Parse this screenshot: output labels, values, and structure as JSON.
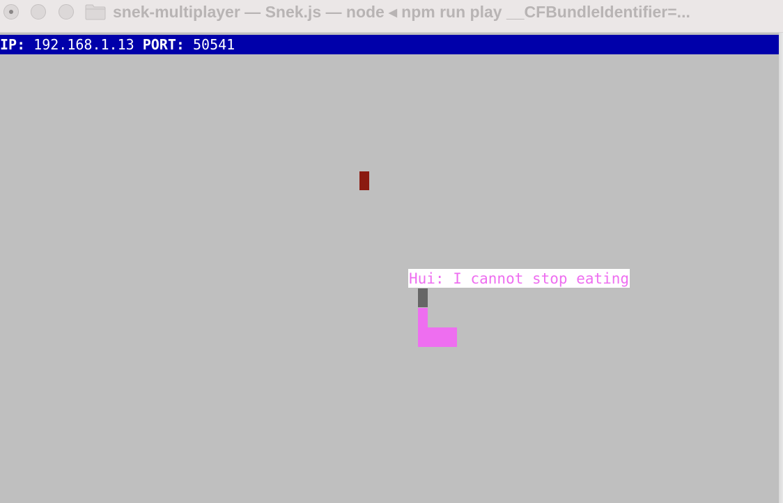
{
  "window": {
    "title": "snek-multiplayer — Snek.js — node ◂ npm run play __CFBundleIdentifier=..."
  },
  "status": {
    "ip_label": "IP:",
    "ip_value": "192.168.1.13",
    "port_label": "PORT:",
    "port_value": "50541"
  },
  "game": {
    "chat": {
      "player": "Hui",
      "message": "Hui: I cannot stop eating"
    },
    "colors": {
      "background": "#bfbfbf",
      "statusbar": "#0000aa",
      "snake": "#ee6ef0",
      "snake_head": "#666666",
      "food": "#8b1a10"
    }
  },
  "icons": {
    "close": "close-button-icon",
    "minimize": "minimize-button-icon",
    "zoom": "zoom-button-icon",
    "folder": "folder-icon"
  }
}
